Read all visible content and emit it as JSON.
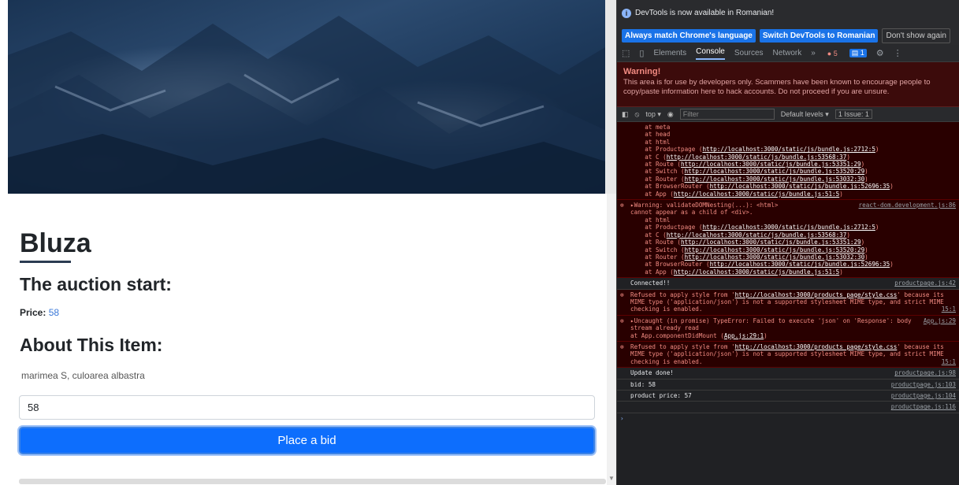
{
  "page": {
    "title": "Bluza",
    "subtitle": "The auction start:",
    "price_label": "Price:",
    "price_value": "58",
    "about_heading": "About This Item:",
    "description": "marimea S, culoarea albastra",
    "bid_input_value": "58",
    "bid_button": "Place a bid"
  },
  "devtools": {
    "info_text": "DevTools is now available in Romanian!",
    "lang_btn_1": "Always match Chrome's language",
    "lang_btn_2": "Switch DevTools to Romanian",
    "lang_dismiss": "Don't show again",
    "tabs": [
      "Elements",
      "Console",
      "Sources",
      "Network"
    ],
    "more": "»",
    "error_count": "5",
    "message_count": "1",
    "warning_title": "Warning!",
    "warning_body": "This area is for use by developers only. Scammers have been known to encourage people to copy/paste information here to hack accounts. Do not proceed if you are unsure.",
    "context": "top ▾",
    "filter_placeholder": "Filter",
    "levels": "Default levels ▾",
    "issues": "1 Issue: ",
    "issues_count": "1"
  },
  "console": {
    "stack1": [
      "    at meta",
      "    at head",
      "    at html",
      "    at Productpage (|http://localhost:3000/static/js/bundle.js:2712:5|)",
      "    at C (|http://localhost:3000/static/js/bundle.js:53568:37|)",
      "    at Route (|http://localhost:3000/static/js/bundle.js:53351:29|)",
      "    at Switch (|http://localhost:3000/static/js/bundle.js:53520:29|)",
      "    at Router (|http://localhost:3000/static/js/bundle.js:53032:30|)",
      "    at BrowserRouter (|http://localhost:3000/static/js/bundle.js:52696:35|)",
      "    at App (|http://localhost:3000/static/js/bundle.js:51:5|)"
    ],
    "warn2_head": "▸Warning: validateDOMNesting(...): <html>",
    "warn2_src": "react-dom.development.js:86",
    "warn2_body": "cannot appear as a child of <div>.",
    "stack2": [
      "    at html",
      "    at Productpage (|http://localhost:3000/static/js/bundle.js:2712:5|)",
      "    at C (|http://localhost:3000/static/js/bundle.js:53568:37|)",
      "    at Route (|http://localhost:3000/static/js/bundle.js:53351:29|)",
      "    at Switch (|http://localhost:3000/static/js/bundle.js:53520:29|)",
      "    at Router (|http://localhost:3000/static/js/bundle.js:53032:30|)",
      "    at BrowserRouter (|http://localhost:3000/static/js/bundle.js:52696:35|)",
      "    at App (|http://localhost:3000/static/js/bundle.js:51:5|)"
    ],
    "connected": "Connected!!",
    "connected_src": "productpage.js:42",
    "refused1_a": "Refused to apply style from '",
    "refused1_link": "http://localhost:3000/products_page/style.css",
    "refused1_b": "' because its MIME type ('application/json') is not a supported stylesheet MIME type, and strict MIME checking is enabled.",
    "refused1_src": "15:1",
    "uncaught_a": "▸Uncaught (in promise) TypeError: Failed to execute 'json' on 'Response': body stream already read",
    "uncaught_src": "App.js:29",
    "uncaught_b": "    at App.componentDidMount (",
    "uncaught_link": "App.js:29:1",
    "uncaught_c": ")",
    "refused2_src": "15:1",
    "update": "Update done!",
    "update_src": "productpage.js:98",
    "bid": "bid: 58",
    "bid_src": "productpage.js:103",
    "product_price": "product price: 57",
    "product_price_src": "productpage.js:104",
    "last_src": "productpage.js:116",
    "prompt": "›"
  }
}
